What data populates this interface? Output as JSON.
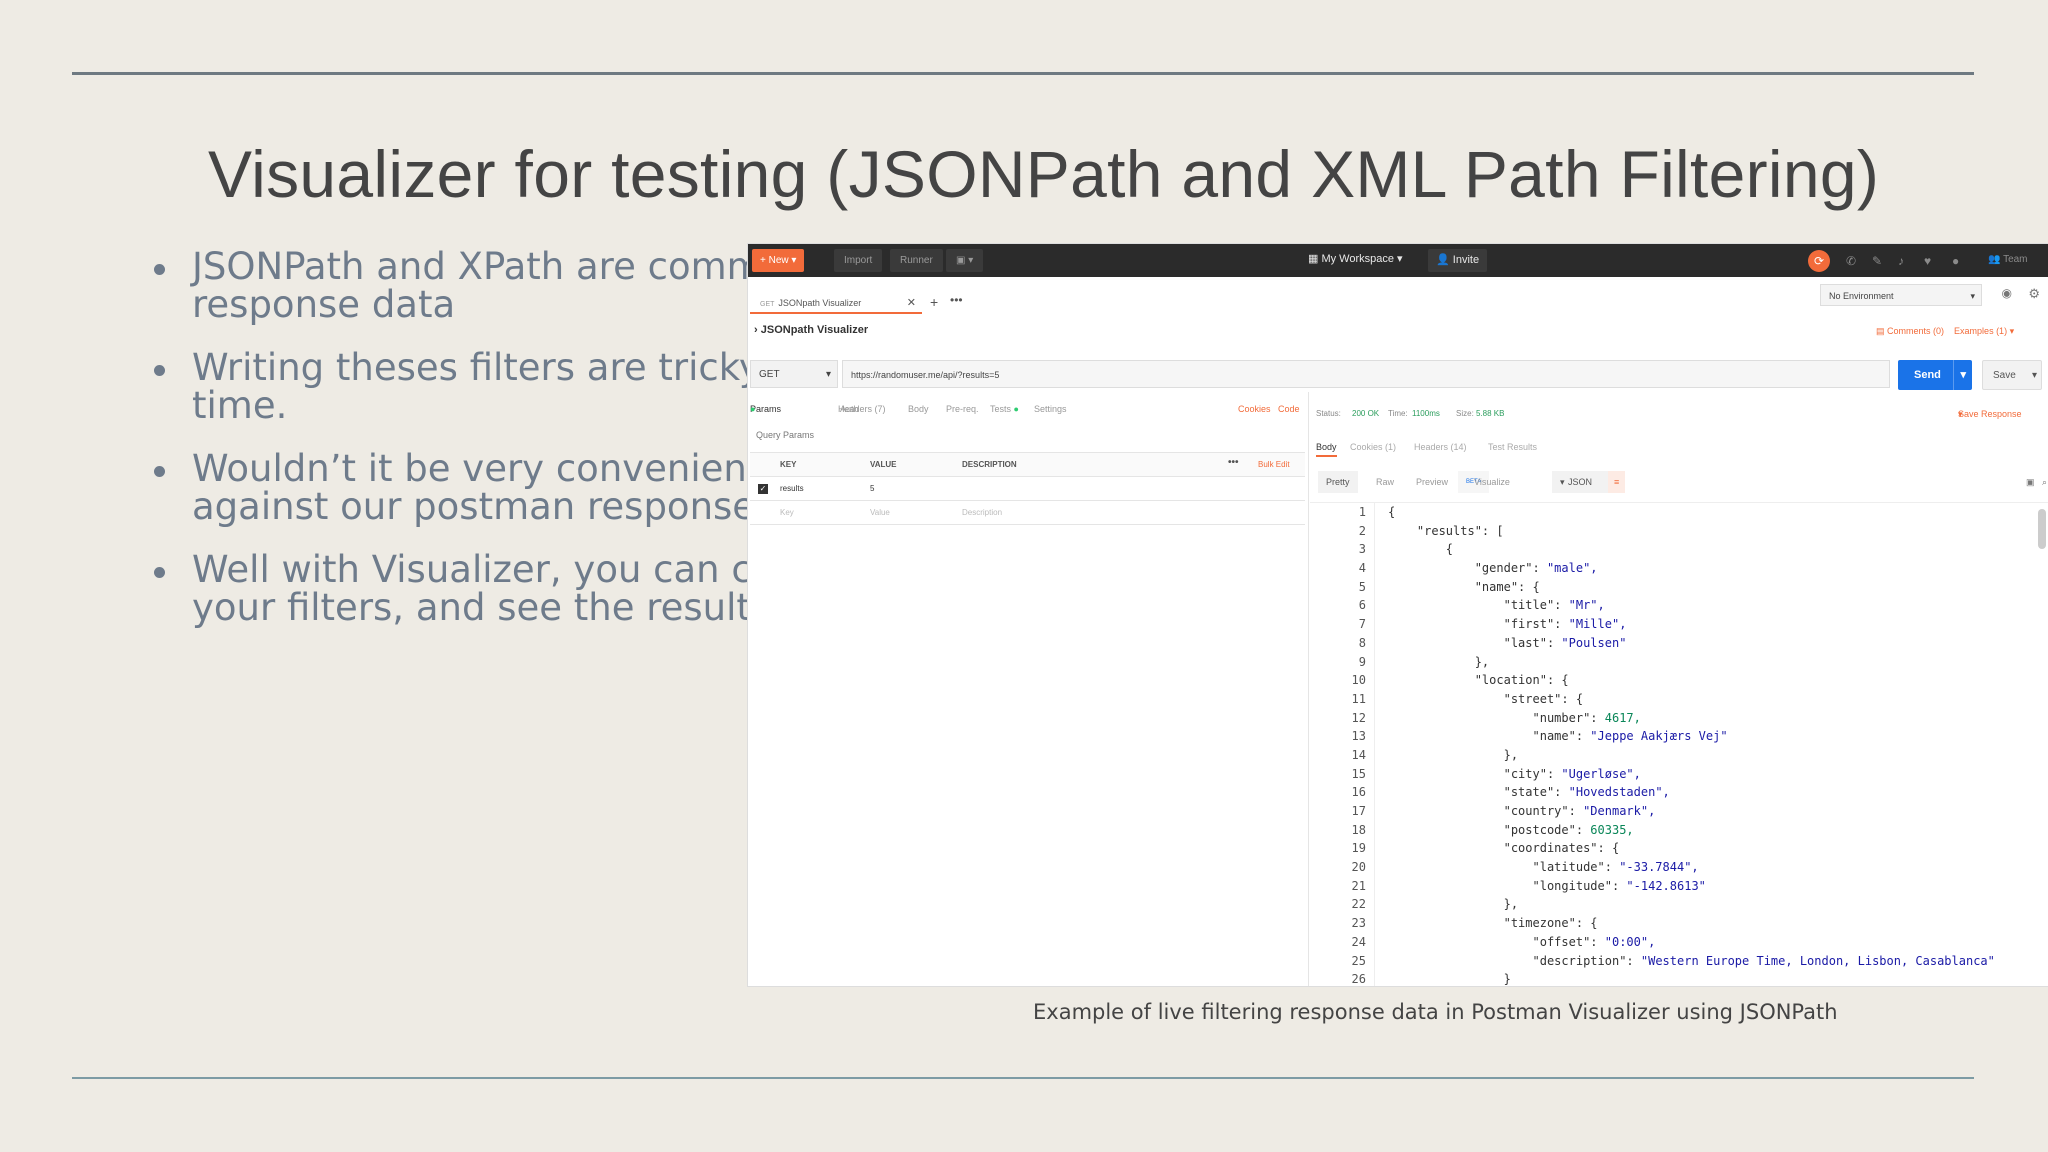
{
  "slide": {
    "title": "Visualizer for testing (JSONPath and XML Path Filtering)",
    "bullets": [
      [
        "JSONPath and XPath are comme",
        "response data"
      ],
      [
        "Writing theses filters are tricky ar",
        "time."
      ],
      [
        "Wouldn’t it be very convenient to",
        "against our postman response, ri"
      ],
      [
        "Well with Visualizer, you can crea",
        "your filters, and see the results as"
      ]
    ],
    "caption": "Example of live filtering response data in Postman Visualizer using JSONPath"
  },
  "postman": {
    "topbar": {
      "new_label": "New",
      "import_label": "Import",
      "runner_label": "Runner",
      "workspace_label": "My Workspace",
      "invite_label": "Invite",
      "team_label": "Team"
    },
    "tab": {
      "method": "GET",
      "label": "JSONpath Visualizer"
    },
    "environment": "No Environment",
    "collection_title": "JSONpath Visualizer",
    "comments_label": "Comments (0)",
    "examples_label": "Examples (1)",
    "request": {
      "method": "GET",
      "url": "https://randomuser.me/api/?results=5",
      "send_label": "Send",
      "save_label": "Save"
    },
    "request_tabs": [
      "Params",
      "Auth",
      "Headers (7)",
      "Body",
      "Pre-req.",
      "Tests",
      "Settings"
    ],
    "cookies_label": "Cookies",
    "code_label": "Code",
    "query_params_label": "Query Params",
    "params_headers": [
      "KEY",
      "VALUE",
      "DESCRIPTION"
    ],
    "bulk_edit_label": "Bulk Edit",
    "params_rows": [
      {
        "key": "results",
        "value": "5",
        "description": ""
      }
    ],
    "params_placeholder": {
      "key": "Key",
      "value": "Value",
      "description": "Description"
    },
    "response": {
      "status": "Status:",
      "status_value": "200 OK",
      "time": "Time:",
      "time_value": "1100ms",
      "size": "Size:",
      "size_value": "5.88 KB",
      "save_response_label": "Save Response",
      "tabs": [
        "Body",
        "Cookies (1)",
        "Headers (14)",
        "Test Results"
      ],
      "formats": [
        "Pretty",
        "Raw",
        "Preview",
        "Visualize"
      ],
      "beta_label": "BETA",
      "format_select": "JSON"
    },
    "code_lines": [
      "{",
      "    \"results\": [",
      "        {",
      "            \"gender\": \"male\",",
      "            \"name\": {",
      "                \"title\": \"Mr\",",
      "                \"first\": \"Mille\",",
      "                \"last\": \"Poulsen\"",
      "            },",
      "            \"location\": {",
      "                \"street\": {",
      "                    \"number\": 4617,",
      "                    \"name\": \"Jeppe Aakjærs Vej\"",
      "                },",
      "                \"city\": \"Ugerløse\",",
      "                \"state\": \"Hovedstaden\",",
      "                \"country\": \"Denmark\",",
      "                \"postcode\": 60335,",
      "                \"coordinates\": {",
      "                    \"latitude\": \"-33.7844\",",
      "                    \"longitude\": \"-142.8613\"",
      "                },",
      "                \"timezone\": {",
      "                    \"offset\": \"0:00\",",
      "                    \"description\": \"Western Europe Time, London, Lisbon, Casablanca\"",
      "                }"
    ],
    "colors": {
      "accent": "#f26b3a",
      "send": "#1a73e8",
      "string": "#1a1aa6",
      "number": "#098658"
    }
  }
}
